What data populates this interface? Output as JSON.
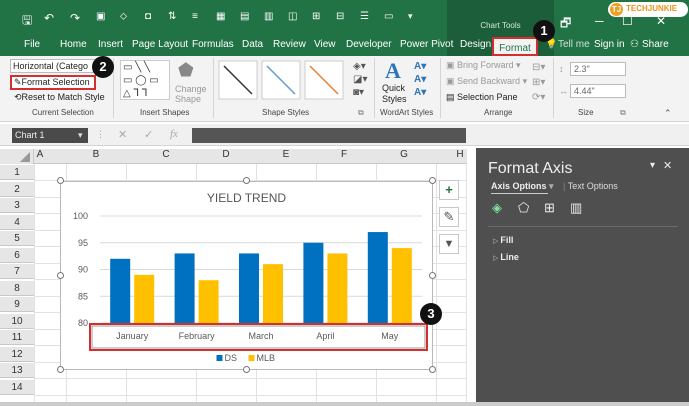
{
  "qat": {
    "save": "🖫",
    "undo": "↶",
    "redo": "↷",
    "more": "▾"
  },
  "chart_tools": "Chart Tools",
  "window": {
    "restore": "🗗",
    "minimize": "─",
    "maximize": "☐",
    "close": "✕"
  },
  "tabs": [
    "File",
    "Home",
    "Insert",
    "Page Layout",
    "Formulas",
    "Data",
    "Review",
    "View",
    "Developer",
    "Power Pivot",
    "Design",
    "Format"
  ],
  "tell_me": "Tell me",
  "sign_in": "Sign in",
  "share": "Share",
  "ribbon": {
    "current_selection": {
      "dropdown": "Horizontal (Catego",
      "format_selection": "Format Selection",
      "reset": "Reset to Match Style",
      "label": "Current Selection"
    },
    "insert_shapes": {
      "change_shape": "Change Shape",
      "label": "Insert Shapes"
    },
    "shape_styles": {
      "label": "Shape Styles"
    },
    "wordart": {
      "quick_styles": "Quick Styles",
      "label": "WordArt Styles"
    },
    "arrange": {
      "bring_forward": "Bring Forward",
      "send_backward": "Send Backward",
      "selection_pane": "Selection Pane",
      "label": "Arrange"
    },
    "size": {
      "height": "2.3\"",
      "width": "4.44\"",
      "label": "Size"
    }
  },
  "name_box": "Chart 1",
  "fx": "fx",
  "columns": [
    "A",
    "B",
    "C",
    "D",
    "E",
    "F",
    "G",
    "H"
  ],
  "rows": [
    "1",
    "2",
    "3",
    "4",
    "5",
    "6",
    "7",
    "8",
    "9",
    "10",
    "11",
    "12",
    "13",
    "14"
  ],
  "chart_data": {
    "type": "bar",
    "title": "YIELD TREND",
    "categories": [
      "January",
      "February",
      "March",
      "April",
      "May"
    ],
    "series": [
      {
        "name": "DS",
        "values": [
          92,
          93,
          93,
          95,
          97
        ],
        "color": "#0070c0"
      },
      {
        "name": "MLB",
        "values": [
          89,
          88,
          91,
          93,
          94
        ],
        "color": "#ffc000"
      }
    ],
    "ylim": [
      80,
      100
    ],
    "yticks": [
      "80",
      "85",
      "90",
      "95",
      "100"
    ],
    "grid": true,
    "legend_position": "bottom"
  },
  "pane": {
    "title": "Format Axis",
    "axis_options": "Axis Options",
    "text_options": "Text Options",
    "fill": "Fill",
    "line": "Line"
  },
  "badges": [
    "1",
    "2",
    "3"
  ],
  "watermark": "TECHJUNKIE",
  "colors": {
    "excel_green": "#217346",
    "accent_red": "#d32f2f"
  }
}
